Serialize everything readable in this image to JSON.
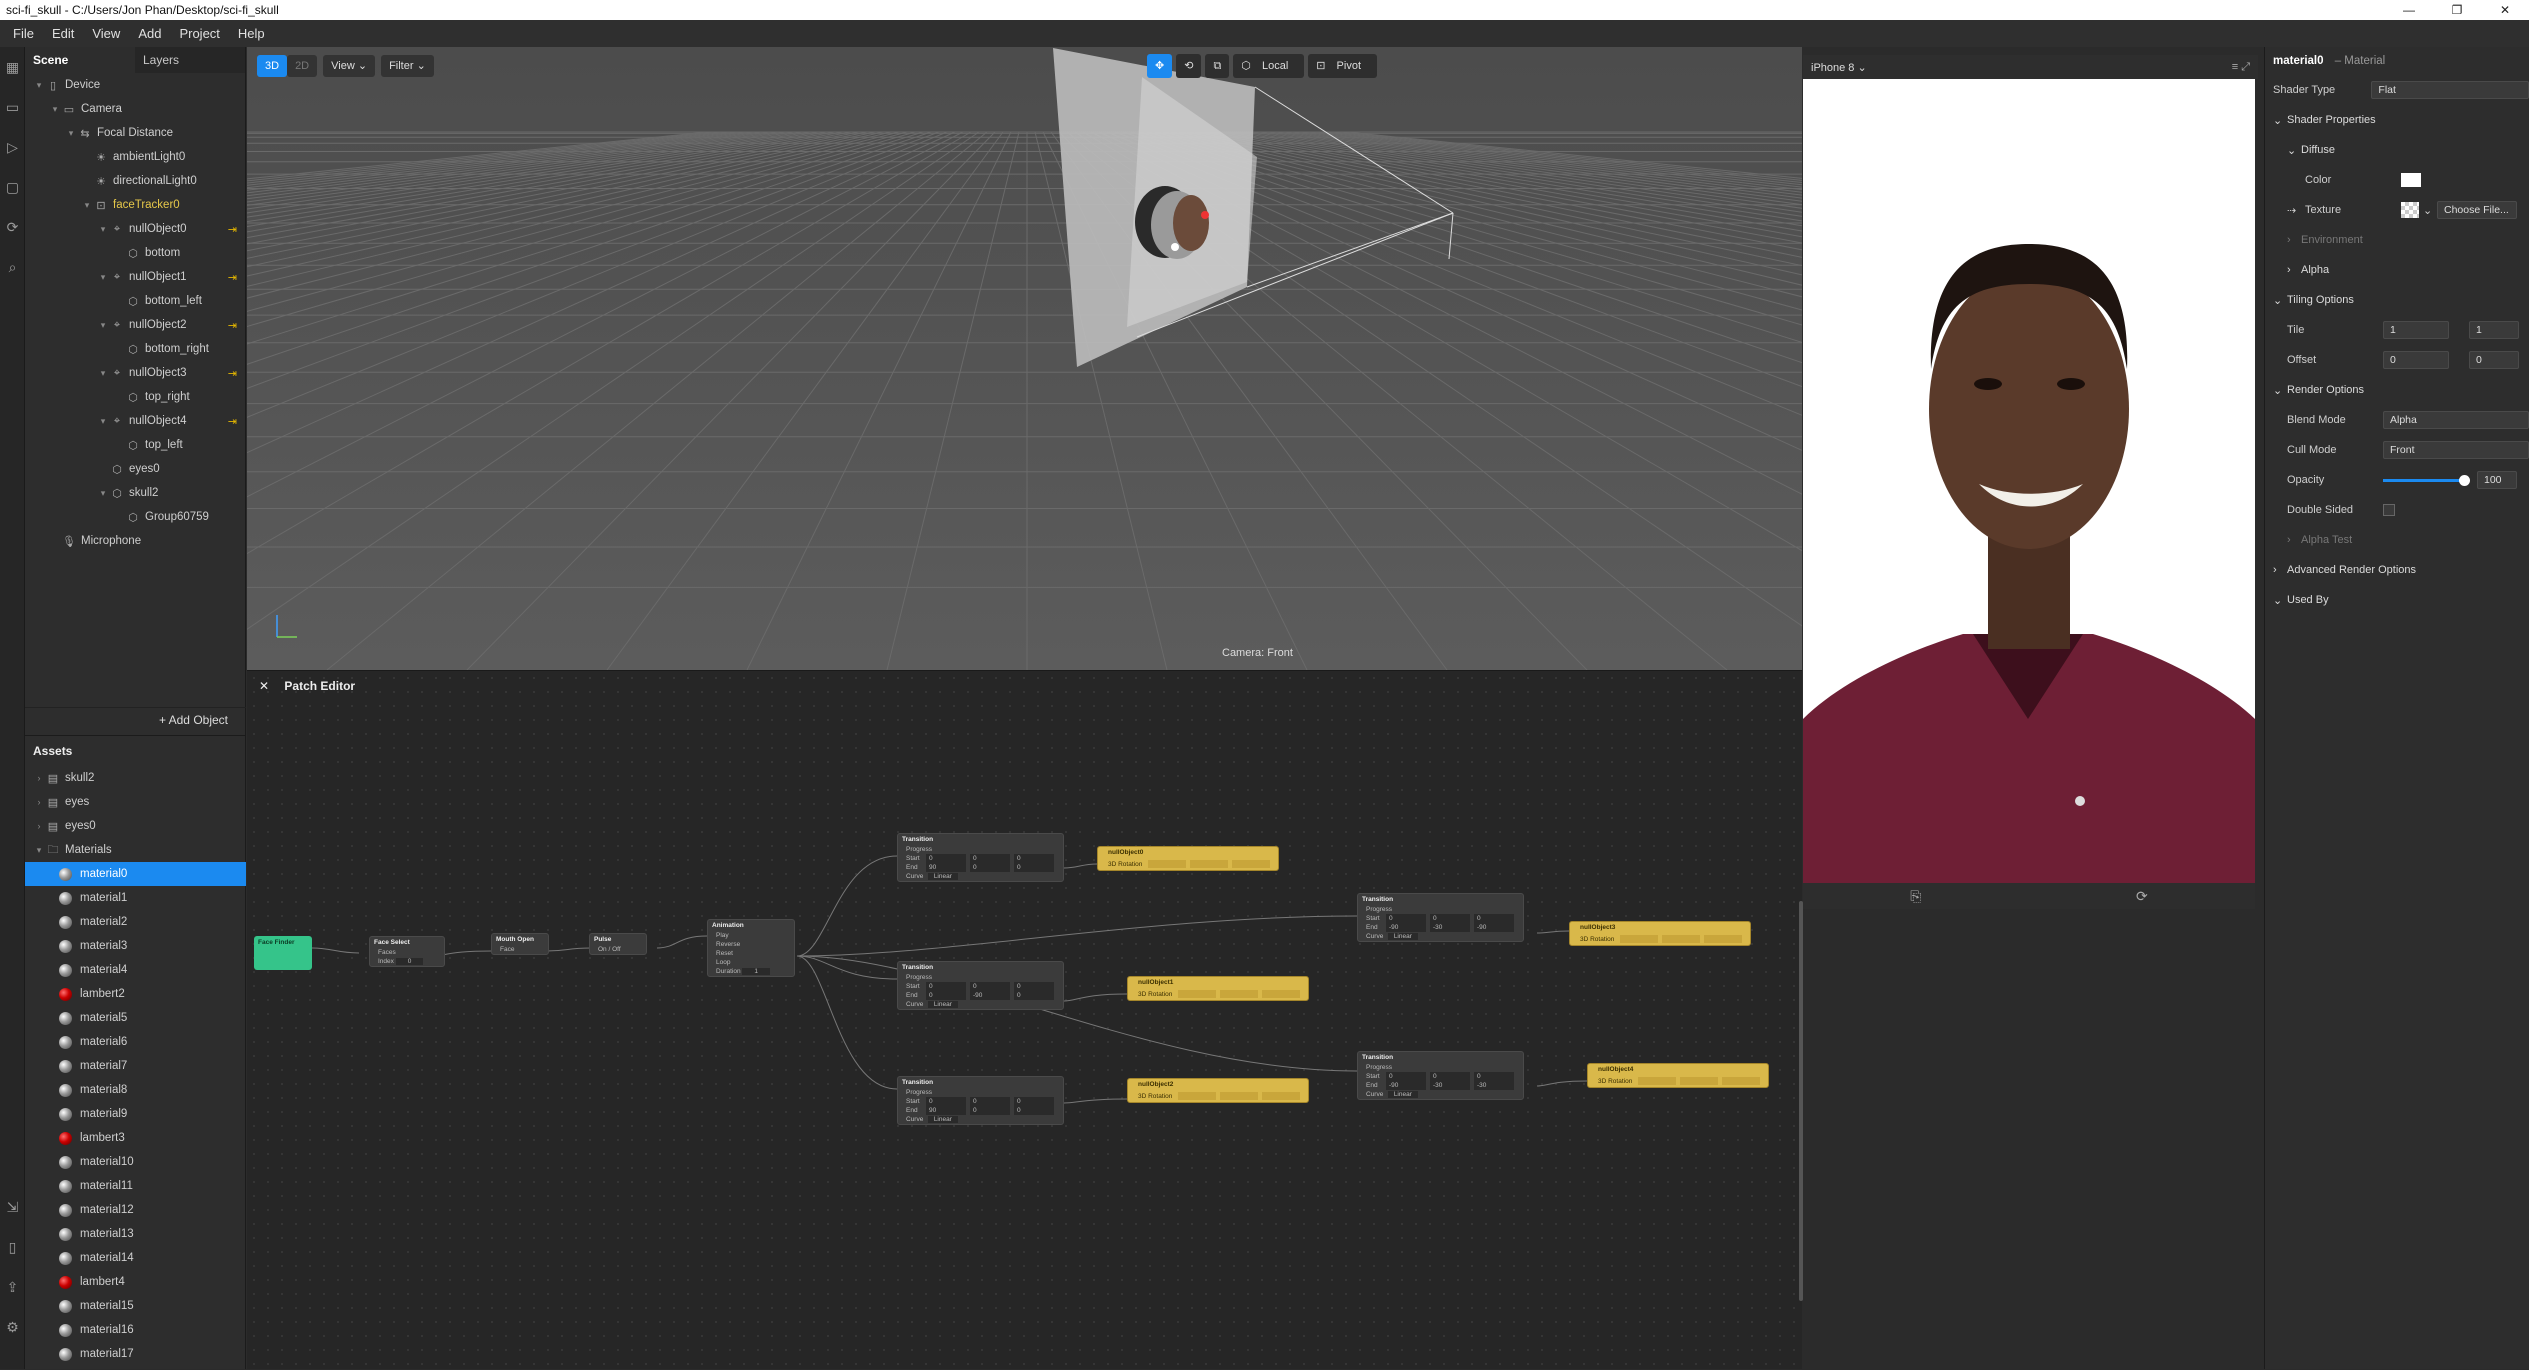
{
  "window": {
    "title": "sci-fi_skull - C:/Users/Jon Phan/Desktop/sci-fi_skull",
    "min": "—",
    "restore": "❐",
    "close": "✕"
  },
  "menu": [
    "File",
    "Edit",
    "View",
    "Add",
    "Project",
    "Help"
  ],
  "scene": {
    "tab_scene": "Scene",
    "tab_layers": "Layers",
    "tree": [
      {
        "label": "Device",
        "depth": 0
      },
      {
        "label": "Camera",
        "depth": 1
      },
      {
        "label": "Focal Distance",
        "depth": 2
      },
      {
        "label": "ambientLight0",
        "depth": 3
      },
      {
        "label": "directionalLight0",
        "depth": 3
      },
      {
        "label": "faceTracker0",
        "depth": 3
      },
      {
        "label": "nullObject0",
        "depth": 4
      },
      {
        "label": "bottom",
        "depth": 5
      },
      {
        "label": "nullObject1",
        "depth": 4
      },
      {
        "label": "bottom_left",
        "depth": 5
      },
      {
        "label": "nullObject2",
        "depth": 4
      },
      {
        "label": "bottom_right",
        "depth": 5
      },
      {
        "label": "nullObject3",
        "depth": 4
      },
      {
        "label": "top_right",
        "depth": 5
      },
      {
        "label": "nullObject4",
        "depth": 4
      },
      {
        "label": "top_left",
        "depth": 5
      },
      {
        "label": "eyes0",
        "depth": 4
      },
      {
        "label": "skull2",
        "depth": 4
      },
      {
        "label": "Group60759",
        "depth": 5
      },
      {
        "label": "Microphone",
        "depth": 1
      }
    ],
    "add_object": "+ Add Object"
  },
  "assets": {
    "header": "Assets",
    "folders": [
      "skull2",
      "eyes",
      "eyes0",
      "Materials"
    ],
    "materials": [
      "material0",
      "material1",
      "material2",
      "material3",
      "material4",
      "lambert2",
      "material5",
      "material6",
      "material7",
      "material8",
      "material9",
      "lambert3",
      "material10",
      "material11",
      "material12",
      "material13",
      "material14",
      "lambert4",
      "material15",
      "material16",
      "material17"
    ],
    "selected": "material0"
  },
  "viewport": {
    "btn_3d": "3D",
    "btn_2d": "2D",
    "view": "View",
    "filter": "Filter",
    "local": "Local",
    "pivot": "Pivot",
    "camera_label": "Camera: Front"
  },
  "patch_editor": {
    "title": "Patch Editor",
    "close": "✕",
    "face_finder": "Face Finder",
    "face_select": {
      "title": "Face Select",
      "faces": "Faces",
      "index": "Index",
      "index_val": "0"
    },
    "mouth_open": {
      "title": "Mouth Open",
      "face": "Face"
    },
    "pulse": {
      "title": "Pulse",
      "onoff": "On / Off"
    },
    "animation": {
      "title": "Animation",
      "rows": [
        "Play",
        "Reverse",
        "Reset",
        "Loop",
        "Duration"
      ],
      "duration": "1"
    },
    "transition_title": "Transition",
    "transition_rows": [
      "Progress",
      "Start",
      "End",
      "Curve"
    ],
    "curve": "Linear",
    "transitions": [
      {
        "start": [
          "0",
          "0",
          "0"
        ],
        "end": [
          "90",
          "0",
          "0"
        ]
      },
      {
        "start": [
          "0",
          "0",
          "0"
        ],
        "end": [
          "0",
          "-90",
          "0"
        ]
      },
      {
        "start": [
          "0",
          "0",
          "0"
        ],
        "end": [
          "90",
          "0",
          "0"
        ]
      },
      {
        "start": [
          "0",
          "0",
          "0"
        ],
        "end": [
          "-90",
          "-30",
          "-90"
        ]
      },
      {
        "start": [
          "0",
          "0",
          "0"
        ],
        "end": [
          "-90",
          "-30",
          "-30"
        ]
      }
    ],
    "rotation_label": "3D Rotation",
    "null_objects": [
      "nullObject0",
      "nullObject1",
      "nullObject2",
      "nullObject3",
      "nullObject4"
    ]
  },
  "preview": {
    "device": "iPhone 8"
  },
  "inspector": {
    "title": "material0",
    "subtitle": "– Material",
    "shader_type_label": "Shader Type",
    "shader_type": "Flat",
    "shader_properties": "Shader Properties",
    "diffuse": "Diffuse",
    "color": "Color",
    "texture": "Texture",
    "choose_file": "Choose File...",
    "environment": "Environment",
    "alpha": "Alpha",
    "tiling_options": "Tiling Options",
    "tile": "Tile",
    "tile_x": "1",
    "tile_y": "1",
    "offset": "Offset",
    "offset_x": "0",
    "offset_y": "0",
    "render_options": "Render Options",
    "blend_mode_label": "Blend Mode",
    "blend_mode": "Alpha",
    "cull_mode_label": "Cull Mode",
    "cull_mode": "Front",
    "opacity_label": "Opacity",
    "opacity": "100",
    "double_sided": "Double Sided",
    "alpha_test": "Alpha Test",
    "advanced_render": "Advanced Render Options",
    "used_by": "Used By"
  }
}
